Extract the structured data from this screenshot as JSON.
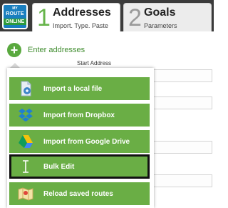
{
  "logo": {
    "top": "MY",
    "middle": "ROUTE",
    "bottom": "ONLINE"
  },
  "tabs": [
    {
      "number": "1",
      "title": "Addresses",
      "subtitle": "Import. Type. Paste",
      "active": true
    },
    {
      "number": "2",
      "title": "Goals",
      "subtitle": "Parameters",
      "active": false
    }
  ],
  "enter_addresses": {
    "icon": "plus-icon",
    "label": "Enter addresses"
  },
  "form": {
    "start_address_label": "Start Address"
  },
  "menu": {
    "items": [
      {
        "label": "Import a local file",
        "icon": "file-icon"
      },
      {
        "label": "Import from Dropbox",
        "icon": "dropbox-icon"
      },
      {
        "label": "Import from Google Drive",
        "icon": "google-drive-icon"
      },
      {
        "label": "Bulk Edit",
        "icon": "text-cursor-icon",
        "selected": true
      },
      {
        "label": "Reload saved routes",
        "icon": "map-icon"
      }
    ]
  },
  "colors": {
    "header_bg": "#3b3b3b",
    "accent_green": "#6aae45",
    "tab_number_green": "#66b44a",
    "link_green": "#3f8c2e",
    "selection_border": "#111111"
  }
}
